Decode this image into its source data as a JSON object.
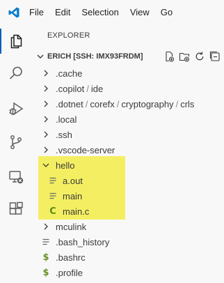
{
  "menubar": {
    "app_icon": "vscode-logo-icon",
    "items": [
      "File",
      "Edit",
      "Selection",
      "View",
      "Go"
    ]
  },
  "activity_bar": {
    "icons": [
      "explorer-icon",
      "search-icon",
      "run-debug-icon",
      "source-control-icon",
      "remote-explorer-icon",
      "extensions-icon"
    ]
  },
  "explorer": {
    "header": "EXPLORER",
    "section_title": "ERICH [SSH: IMX93FRDM]",
    "actions": [
      "new-file-icon",
      "new-folder-icon",
      "refresh-icon",
      "collapse-all-icon"
    ],
    "tree": {
      "cache": ".cache",
      "copilot": ".copilot",
      "ide": "ide",
      "dotnet": ".dotnet",
      "corefx": "corefx",
      "cryptography": "cryptography",
      "crls": "crls",
      "local": ".local",
      "ssh": ".ssh",
      "vscode_server": ".vscode-server",
      "hello": "hello",
      "a_out": "a.out",
      "main": "main",
      "main_c": "main.c",
      "mculink": "mculink",
      "bash_history": ".bash_history",
      "bashrc": ".bashrc",
      "profile": ".profile"
    },
    "highlight_color": "#f2ed4c",
    "accent_color": "#005fb8"
  }
}
